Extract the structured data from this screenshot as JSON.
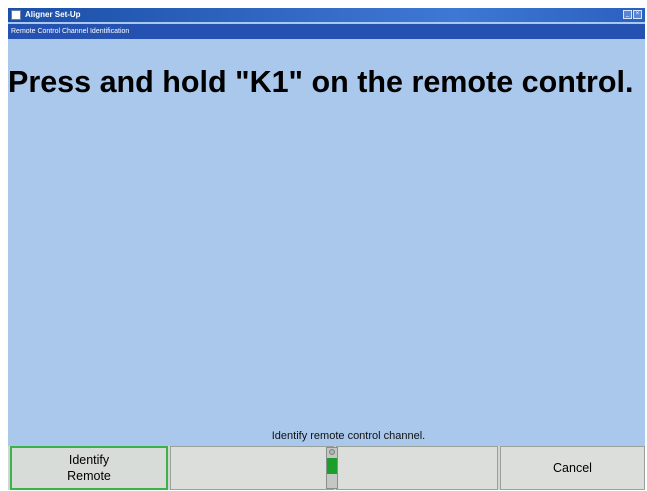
{
  "window": {
    "title": "Aligner Set-Up",
    "subtitle": "Remote Control Channel Identification",
    "controls": [
      "_",
      "×"
    ]
  },
  "main": {
    "instruction": "Press and hold \"K1\" on the remote control."
  },
  "status": {
    "message": "Identify remote control channel."
  },
  "softkeys": [
    {
      "label": "Identify\nRemote",
      "active": true
    },
    {
      "label": "",
      "active": false
    },
    {
      "label": "",
      "active": false
    },
    {
      "label": "Cancel",
      "active": false
    }
  ],
  "indicator": {
    "level": 0.4
  },
  "colors": {
    "background": "#a9c8ec",
    "titlebar": "#1b4fa8",
    "active_border": "#3bb34a",
    "indicator_fill": "#1aa02a"
  }
}
